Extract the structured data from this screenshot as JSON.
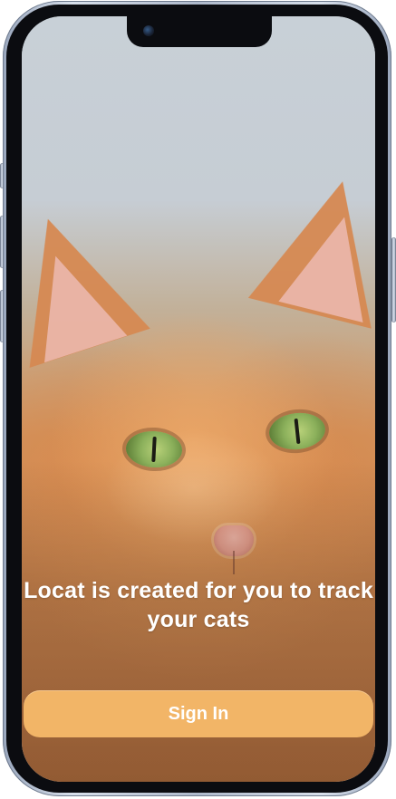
{
  "app": {
    "headline": "Locat is created for you to track your cats",
    "primary_action_label": "Sign In"
  },
  "colors": {
    "button_bg": "#f2b567",
    "text_primary": "#ffffff"
  },
  "icons": {
    "camera": "front-camera-icon"
  }
}
